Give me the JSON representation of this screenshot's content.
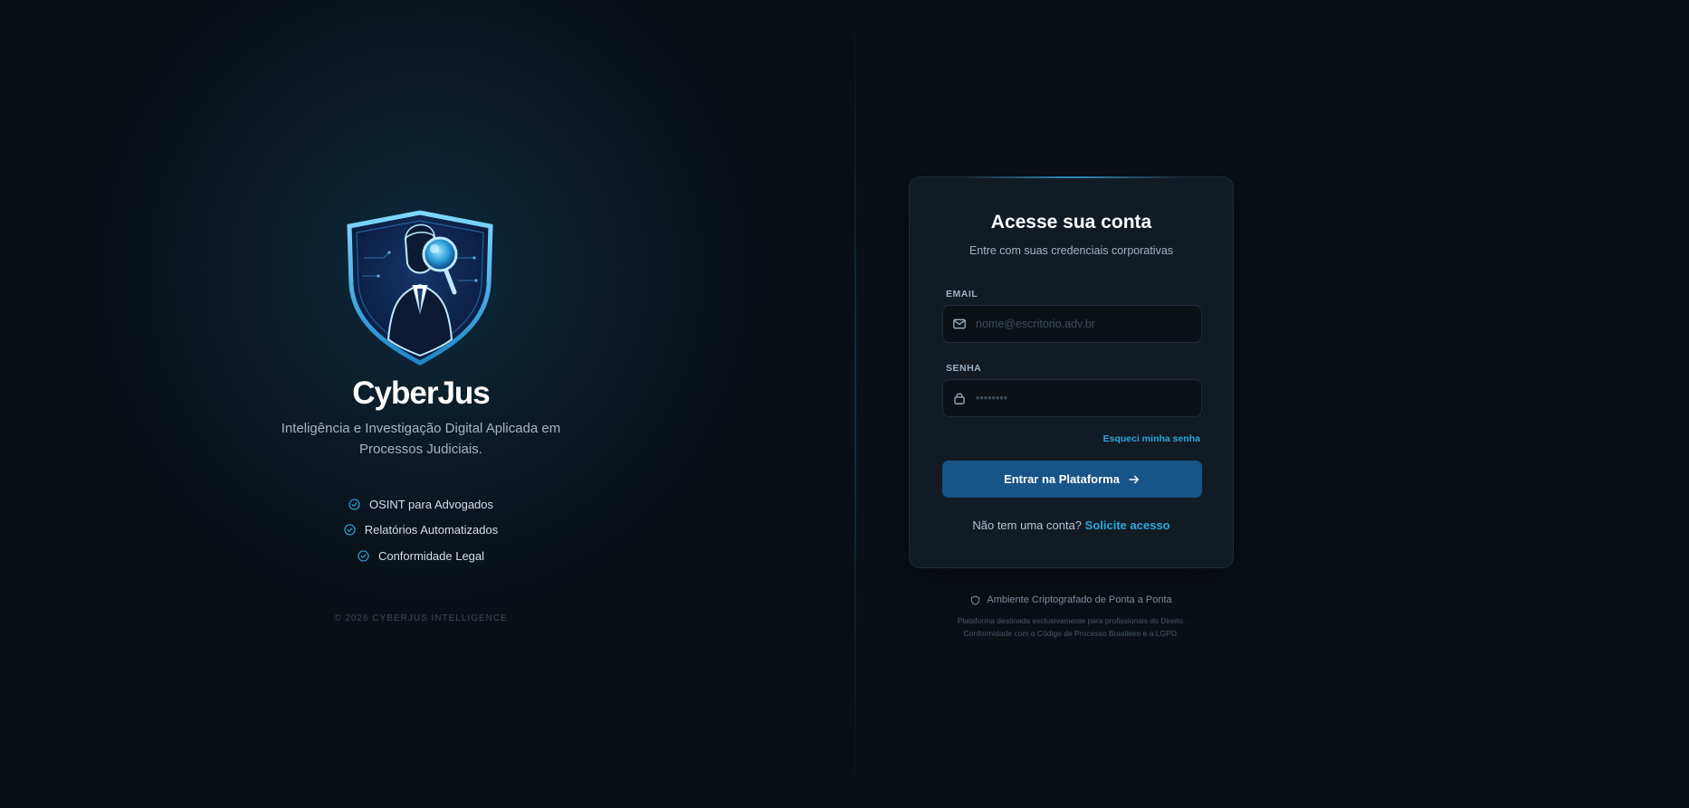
{
  "brand": {
    "name": "CyberJus",
    "tagline": "Inteligência e Investigação Digital Aplicada em Processos Judiciais.",
    "logo_icon": "shield-detective-magnifier-icon",
    "features": [
      {
        "label": "OSINT para Advogados",
        "icon": "check-circle-icon"
      },
      {
        "label": "Relatórios Automatizados",
        "icon": "check-circle-icon"
      },
      {
        "label": "Conformidade Legal",
        "icon": "check-circle-icon"
      }
    ],
    "copyright": "© 2026 CYBERJUS INTELLIGENCE"
  },
  "login": {
    "title": "Acesse sua conta",
    "subtitle": "Entre com suas credenciais corporativas",
    "email": {
      "label": "EMAIL",
      "placeholder": "nome@escritorio.adv.br",
      "value": "",
      "icon": "mail-icon"
    },
    "password": {
      "label": "SENHA",
      "placeholder": "••••••••",
      "value": "",
      "icon": "lock-icon"
    },
    "forgot_label": "Esqueci minha senha",
    "submit_label": "Entrar na Plataforma",
    "signup_prompt": "Não tem uma conta?",
    "signup_link": "Solicite acesso"
  },
  "footer": {
    "secure_label": "Ambiente Criptografado de Ponta a Ponta",
    "secure_icon": "shield-outline-icon",
    "disclaimer_line1": "Plataforma destinada exclusivamente para profissionais do Direito.",
    "disclaimer_line2": "Conformidade com o Código de Processo Brasileiro e a LGPD."
  },
  "colors": {
    "background": "#0a1016",
    "card": "#121b24",
    "accent": "#2aa8e0",
    "button": "#175488"
  }
}
